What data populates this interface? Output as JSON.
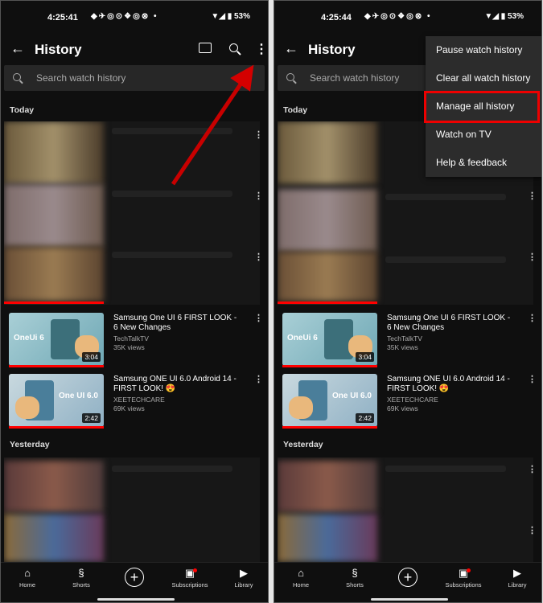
{
  "left": {
    "status": {
      "time": "4:25:41",
      "battery": "53%"
    },
    "title": "History",
    "search_placeholder": "Search watch history",
    "sections": {
      "today": "Today",
      "yesterday": "Yesterday"
    },
    "videos": [
      {
        "title": "Samsung One UI 6 FIRST LOOK - 6 New Changes",
        "channel": "TechTalkTV",
        "views": "35K views",
        "duration": "3:04",
        "tag": "OneUi 6"
      },
      {
        "title": "Samsung ONE UI 6.0 Android 14 - FIRST LOOK! 😍",
        "channel": "XEETECHCARE",
        "views": "69K views",
        "duration": "2:42",
        "tag": "One UI 6.0"
      }
    ]
  },
  "right": {
    "status": {
      "time": "4:25:44",
      "battery": "53%"
    },
    "title": "History",
    "search_placeholder": "Search watch history",
    "sections": {
      "today": "Today",
      "yesterday": "Yesterday"
    },
    "menu": {
      "pause": "Pause watch history",
      "clear": "Clear all watch history",
      "manage": "Manage all history",
      "tv": "Watch on TV",
      "help": "Help & feedback"
    },
    "videos": [
      {
        "title": "Samsung One UI 6 FIRST LOOK - 6 New Changes",
        "channel": "TechTalkTV",
        "views": "35K views",
        "duration": "3:04",
        "tag": "OneUi 6"
      },
      {
        "title": "Samsung ONE UI 6.0 Android 14 - FIRST LOOK! 😍",
        "channel": "XEETECHCARE",
        "views": "69K views",
        "duration": "2:42",
        "tag": "One UI 6.0"
      }
    ]
  },
  "nav": {
    "home": "Home",
    "shorts": "Shorts",
    "subscriptions": "Subscriptions",
    "library": "Library"
  },
  "colors": {
    "accent": "#ff0000",
    "highlight": "#e00000",
    "background": "#0f0f0f",
    "menu": "#2c2c2c"
  }
}
